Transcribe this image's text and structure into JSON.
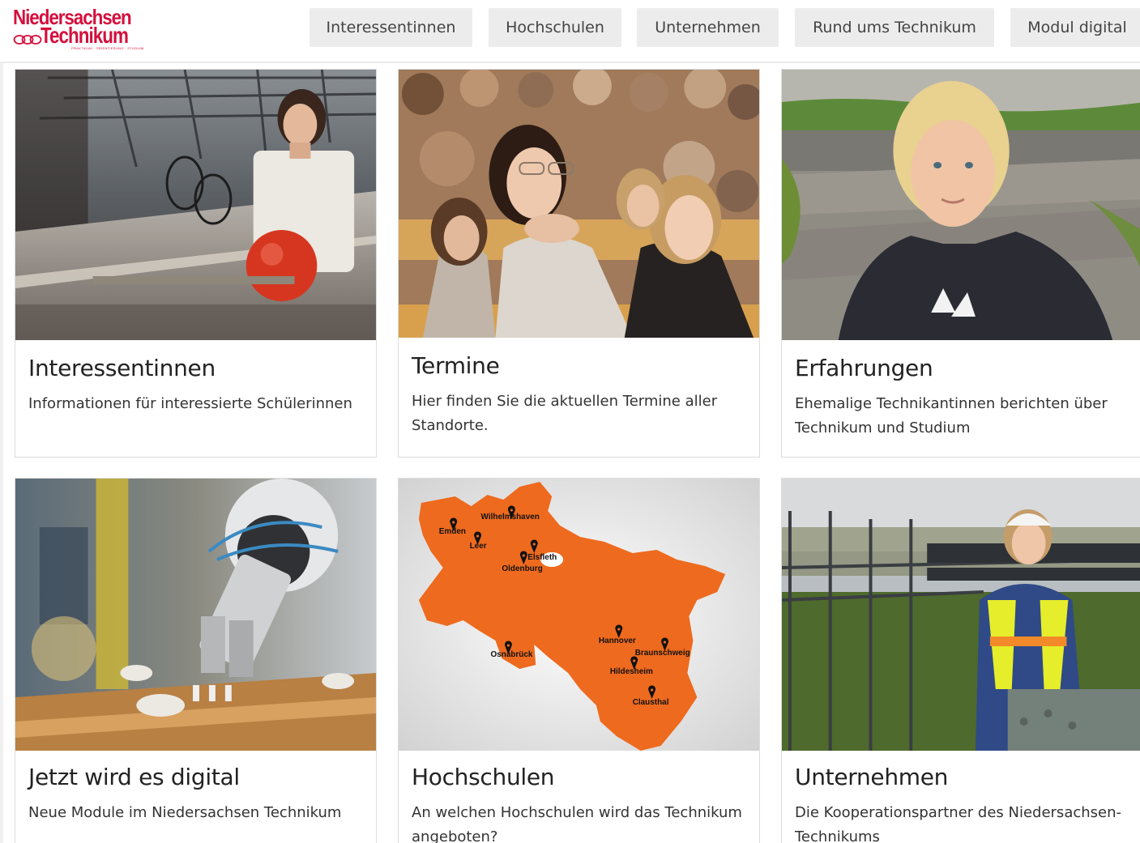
{
  "logo": {
    "line1": "Niedersachsen",
    "line2": "Technikum",
    "subline": "PRAKTIKUM · ORIENTIERUNG · STUDIUM",
    "brand_color": "#d40f3c"
  },
  "nav": {
    "items": [
      {
        "label": "Interessentinnen"
      },
      {
        "label": "Hochschulen"
      },
      {
        "label": "Unternehmen"
      },
      {
        "label": "Rund ums Technikum"
      },
      {
        "label": "Modul digital"
      }
    ]
  },
  "cards": [
    {
      "title": "Interessentinnen",
      "text": "Informationen für interessierte Schülerinnen",
      "image": "photo-student-presenting"
    },
    {
      "title": "Termine",
      "text": "Hier finden Sie die aktuellen Termine aller Standorte.",
      "image": "photo-lecture-hall-audience"
    },
    {
      "title": "Erfahrungen",
      "text": "Ehemalige Technikantinnen berichten über Technikum und Studium",
      "image": "photo-blonde-woman-portrait"
    },
    {
      "title": "Jetzt wird es digital",
      "text": "Neue Module im Niedersachsen Technikum",
      "image": "photo-robot-gripper"
    },
    {
      "title": "Hochschulen",
      "text": "An welchen Hochschulen wird das Technikum angeboten?",
      "image": "map-lower-saxony-locations"
    },
    {
      "title": "Unternehmen",
      "text": "Die Kooperationspartner des Niedersachsen-Technikums",
      "image": "photo-woman-substation-helmet"
    }
  ],
  "map": {
    "fill_color": "#ee6a1e",
    "locations": [
      "Wilhelmshaven",
      "Emden",
      "Leer",
      "Elsfleth",
      "Oldenburg",
      "Osnabrück",
      "Hannover",
      "Braunschweig",
      "Hildesheim",
      "Clausthal"
    ]
  }
}
